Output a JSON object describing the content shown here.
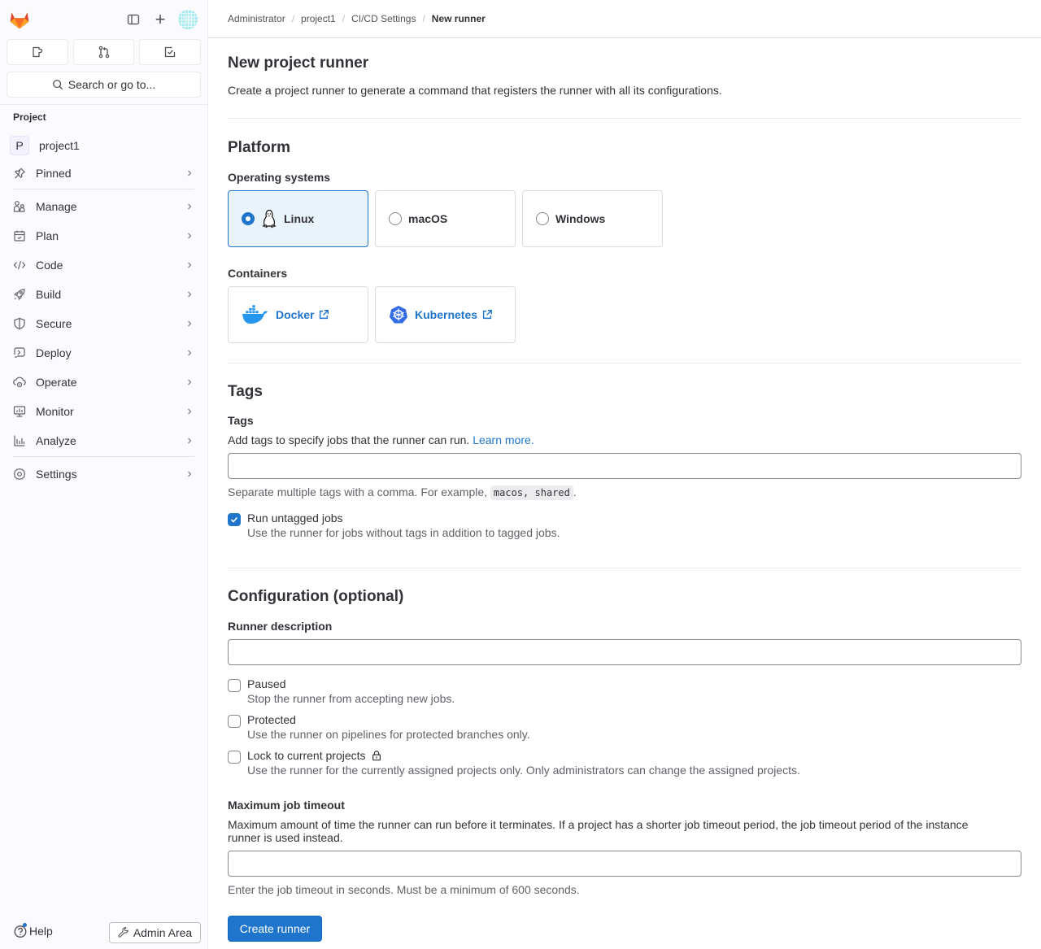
{
  "sidebar": {
    "search_label": "Search or go to...",
    "section_title": "Project",
    "project": {
      "avatar_letter": "P",
      "name": "project1"
    },
    "items": [
      {
        "label": "Pinned",
        "icon": "thumbtack-icon"
      },
      {
        "label": "Manage",
        "icon": "users-icon"
      },
      {
        "label": "Plan",
        "icon": "calendar-icon"
      },
      {
        "label": "Code",
        "icon": "code-icon"
      },
      {
        "label": "Build",
        "icon": "rocket-icon"
      },
      {
        "label": "Secure",
        "icon": "shield-icon"
      },
      {
        "label": "Deploy",
        "icon": "deploy-icon"
      },
      {
        "label": "Operate",
        "icon": "cloud-gear-icon"
      },
      {
        "label": "Monitor",
        "icon": "monitor-icon"
      },
      {
        "label": "Analyze",
        "icon": "chart-icon"
      },
      {
        "label": "Settings",
        "icon": "gear-icon"
      }
    ],
    "help_label": "Help",
    "admin_label": "Admin Area"
  },
  "breadcrumb": [
    "Administrator",
    "project1",
    "CI/CD Settings",
    "New runner"
  ],
  "page": {
    "title": "New project runner",
    "description": "Create a project runner to generate a command that registers the runner with all its configurations."
  },
  "platform": {
    "title": "Platform",
    "os_label": "Operating systems",
    "os_options": [
      {
        "label": "Linux",
        "selected": true
      },
      {
        "label": "macOS",
        "selected": false
      },
      {
        "label": "Windows",
        "selected": false
      }
    ],
    "containers_label": "Containers",
    "containers": [
      {
        "label": "Docker"
      },
      {
        "label": "Kubernetes"
      }
    ]
  },
  "tags": {
    "title": "Tags",
    "label": "Tags",
    "description": "Add tags to specify jobs that the runner can run.",
    "learn_more": "Learn more.",
    "input_value": "",
    "hint_prefix": "Separate multiple tags with a comma. For example,",
    "hint_code": "macos, shared",
    "hint_suffix": ".",
    "run_untagged": {
      "label": "Run untagged jobs",
      "help": "Use the runner for jobs without tags in addition to tagged jobs.",
      "checked": true
    }
  },
  "config": {
    "title": "Configuration (optional)",
    "description_label": "Runner description",
    "description_value": "",
    "options": [
      {
        "label": "Paused",
        "help": "Stop the runner from accepting new jobs.",
        "checked": false
      },
      {
        "label": "Protected",
        "help": "Use the runner on pipelines for protected branches only.",
        "checked": false
      },
      {
        "label": "Lock to current projects",
        "help": "Use the runner for the currently assigned projects only. Only administrators can change the assigned projects.",
        "checked": false
      }
    ],
    "timeout_label": "Maximum job timeout",
    "timeout_description": "Maximum amount of time the runner can run before it terminates. If a project has a shorter job timeout period, the job timeout period of the instance runner is used instead.",
    "timeout_value": "",
    "timeout_hint": "Enter the job timeout in seconds. Must be a minimum of 600 seconds."
  },
  "actions": {
    "create_label": "Create runner"
  },
  "colors": {
    "accent": "#1f75cb",
    "selected_bg": "#e9f3fc"
  }
}
